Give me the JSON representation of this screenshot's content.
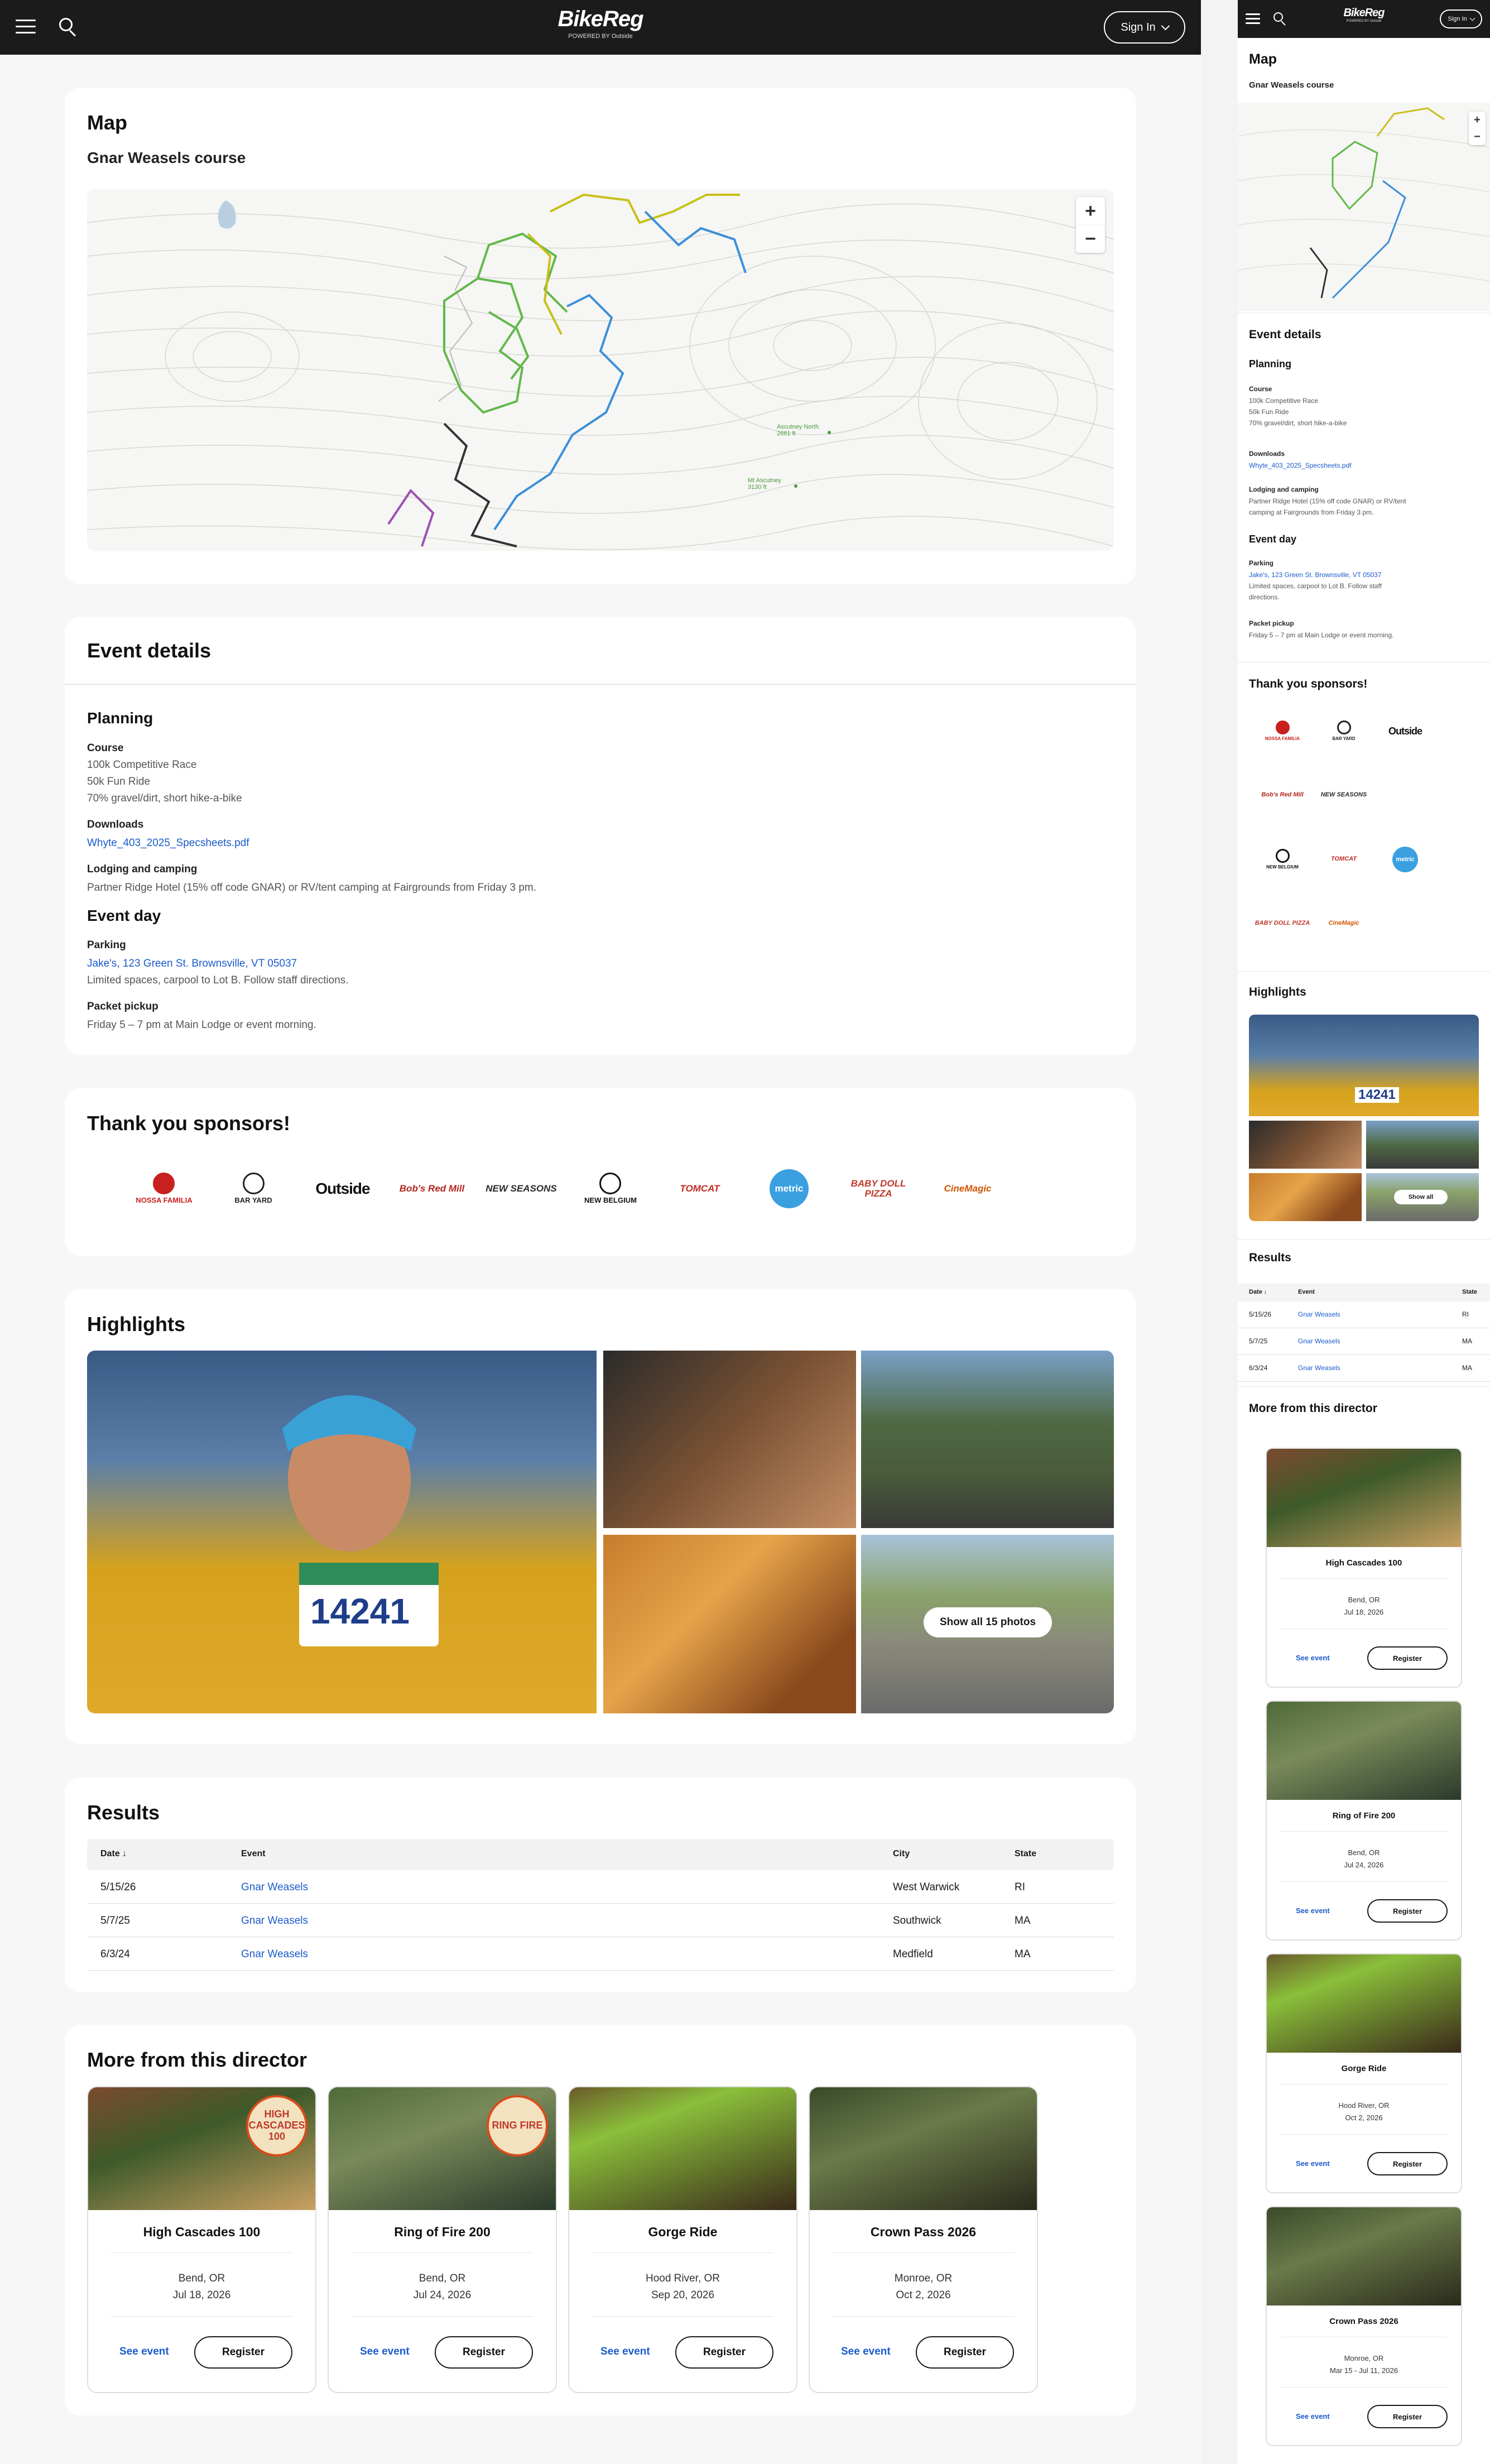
{
  "brand": {
    "logo": "BikeReg",
    "sub": "POWERED BY Outside"
  },
  "header": {
    "signin": "Sign In",
    "signin_m": "Sign In"
  },
  "map": {
    "title": "Map",
    "course": "Gnar Weasels course",
    "zoom_in": "+",
    "zoom_out": "−",
    "peak1": "Ascutney North 2661 ft",
    "peak2": "Mt Ascutney 3130 ft"
  },
  "event": {
    "title": "Event details",
    "planning": "Planning",
    "course_label": "Course",
    "course_lines": [
      "100k Competitive Race",
      "50k Fun Ride",
      "70% gravel/dirt, short hike-a-bike"
    ],
    "downloads_label": "Downloads",
    "download_file": "Whyte_403_2025_Specsheets.pdf",
    "lodging_label": "Lodging and camping",
    "lodging_text": "Partner Ridge Hotel (15% off code GNAR) or RV/tent camping at Fairgrounds from Friday 3 pm.",
    "lodging_m1": "Partner Ridge Hotel (15% off code GNAR) or RV/tent",
    "lodging_m2": "camping at Fairgrounds from Friday 3 pm.",
    "eventday": "Event day",
    "parking_label": "Parking",
    "parking_link": "Jake's, 123 Green St. Brownsville, VT 05037",
    "parking_note": "Limited spaces, carpool to Lot B. Follow staff directions.",
    "parking_m1": "Limited spaces, carpool to Lot B. Follow staff",
    "parking_m2": "directions.",
    "packet_label": "Packet pickup",
    "packet_text": "Friday 5 – 7 pm at Main Lodge or event morning."
  },
  "sponsors": {
    "title": "Thank you sponsors!",
    "items": [
      {
        "name": "NOSSA FAMILIA",
        "color": "#c8201e"
      },
      {
        "name": "BAR YARD",
        "color": "#222222"
      },
      {
        "name": "Outside",
        "color": "#111111"
      },
      {
        "name": "Bob's Red Mill",
        "color": "#b3261e"
      },
      {
        "name": "NEW SEASONS",
        "color": "#2a2a2a"
      },
      {
        "name": "NEW BELGIUM",
        "color": "#111111"
      },
      {
        "name": "TOMCAT",
        "color": "#c22a23"
      },
      {
        "name": "metric",
        "color": "#3aa0e0"
      },
      {
        "name": "BABY DOLL PIZZA",
        "color": "#c0392b"
      },
      {
        "name": "CineMagic",
        "color": "#d35400"
      }
    ]
  },
  "highlights": {
    "title": "Highlights",
    "show_all": "Show all 15 photos",
    "show_all_m": "Show all",
    "bib": "14241"
  },
  "results": {
    "title": "Results",
    "columns": [
      "Date",
      "Event",
      "City",
      "State"
    ],
    "rows": [
      {
        "date": "5/15/26",
        "event": "Gnar Weasels",
        "city": "West Warwick",
        "state": "RI"
      },
      {
        "date": "5/7/25",
        "event": "Gnar Weasels",
        "city": "Southwick",
        "state": "MA"
      },
      {
        "date": "6/3/24",
        "event": "Gnar Weasels",
        "city": "Medfield",
        "state": "MA"
      }
    ]
  },
  "director": {
    "title": "More from this director",
    "see_event": "See event",
    "register": "Register",
    "cards": [
      {
        "name": "High Cascades 100",
        "city": "Bend, OR",
        "date": "Jul 18, 2026",
        "badge": "HIGH CASCADES 100"
      },
      {
        "name": "Ring of Fire 200",
        "city": "Bend, OR",
        "date": "Jul 24, 2026",
        "badge": "RING FIRE"
      },
      {
        "name": "Gorge Ride",
        "city": "Hood River, OR",
        "date": "Sep 20, 2026",
        "badge": ""
      },
      {
        "name": "Crown Pass 2026",
        "city": "Monroe, OR",
        "date": "Oct 2, 2026",
        "badge": ""
      }
    ],
    "mobile_cards": [
      {
        "name": "High Cascades 100",
        "city": "Bend, OR",
        "date": "Jul 18, 2026"
      },
      {
        "name": "Ring of Fire 200",
        "city": "Bend, OR",
        "date": "Jul 24, 2026"
      },
      {
        "name": "Gorge Ride",
        "city": "Hood River, OR",
        "date": "Oct 2, 2026"
      },
      {
        "name": "Crown Pass 2026",
        "city": "Monroe, OR",
        "date": "Mar 15 - Jul 11, 2026"
      }
    ]
  }
}
